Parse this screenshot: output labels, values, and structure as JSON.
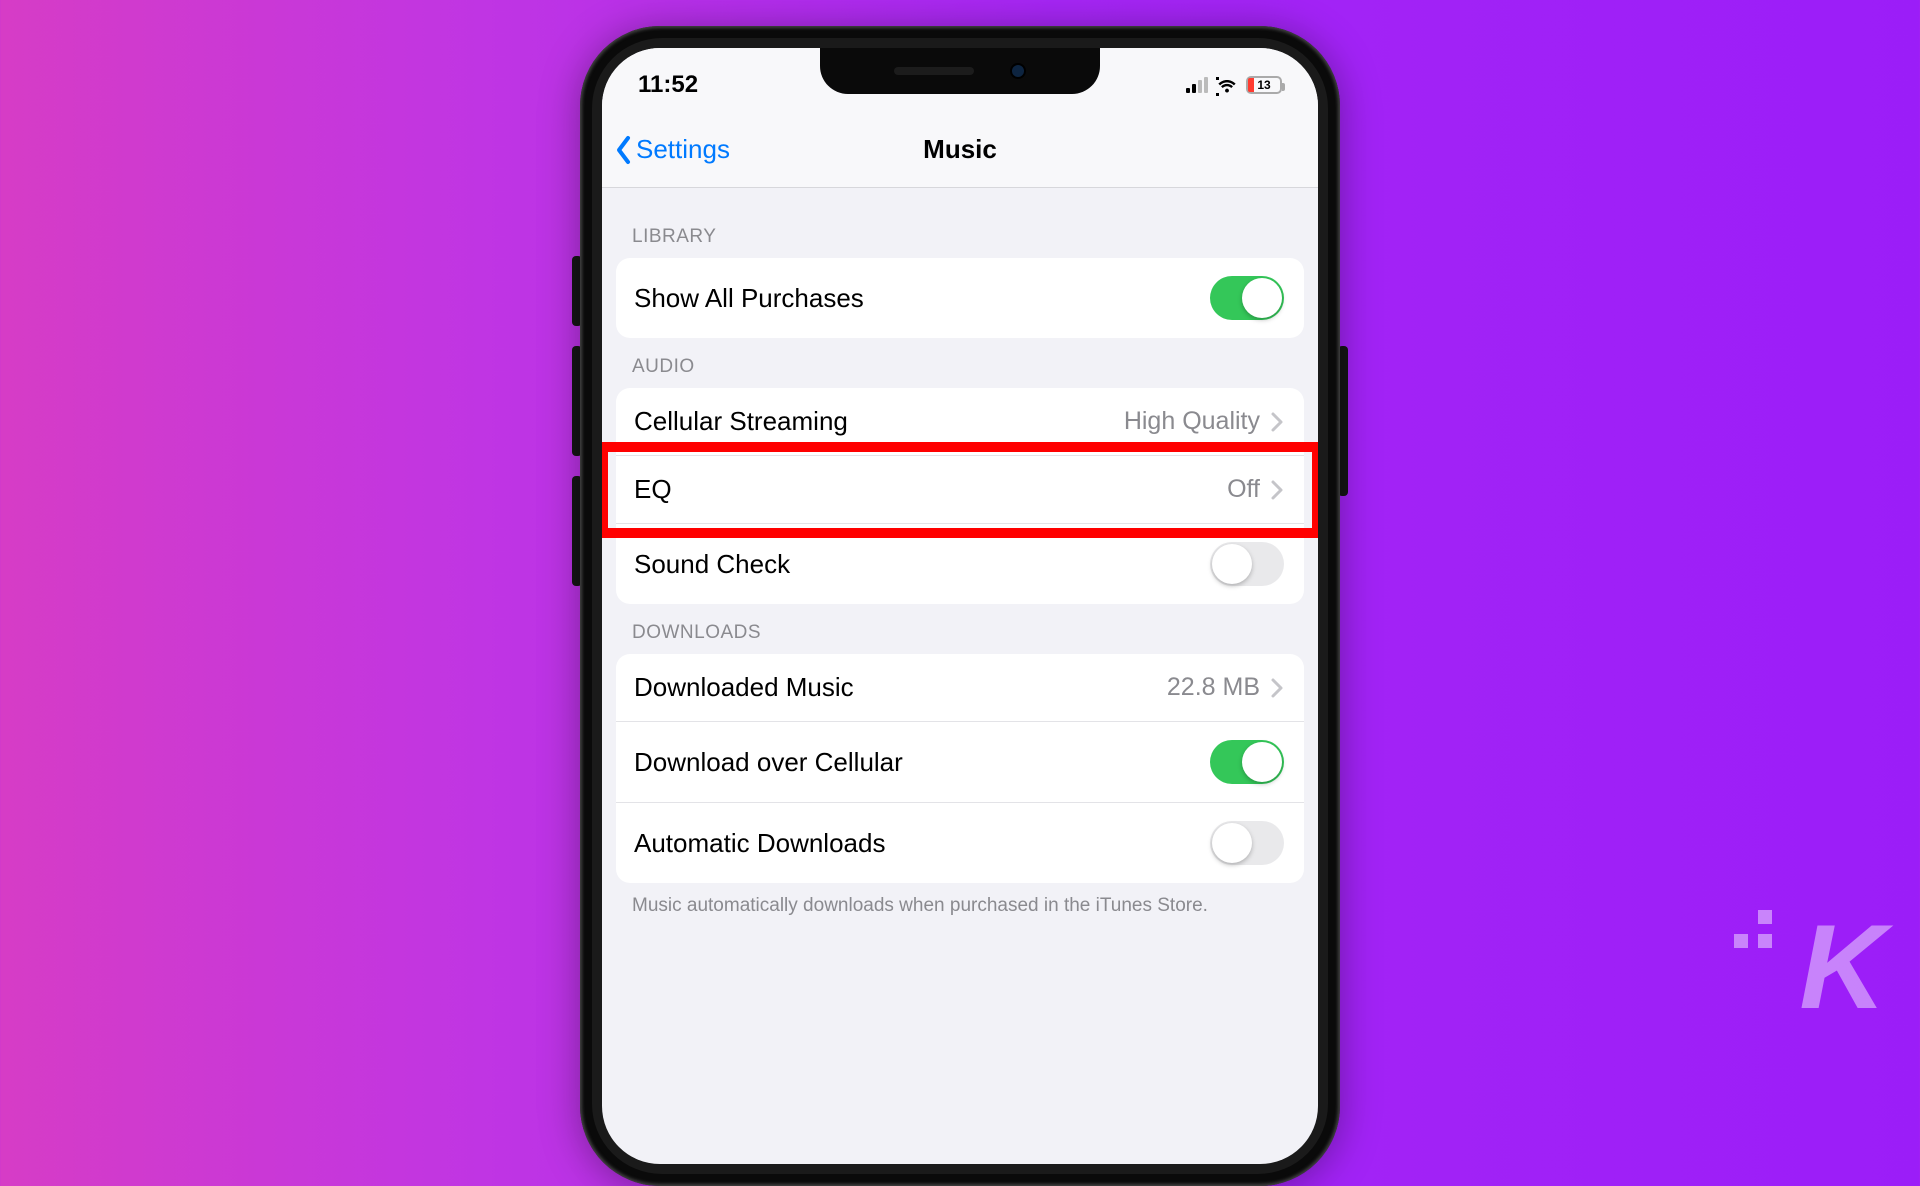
{
  "status": {
    "time": "11:52",
    "battery_percent": "13"
  },
  "nav": {
    "back_label": "Settings",
    "title": "Music"
  },
  "sections": {
    "library": {
      "header": "LIBRARY",
      "show_all_purchases": {
        "label": "Show All Purchases",
        "on": true
      }
    },
    "audio": {
      "header": "AUDIO",
      "cellular_streaming": {
        "label": "Cellular Streaming",
        "value": "High Quality"
      },
      "eq": {
        "label": "EQ",
        "value": "Off"
      },
      "sound_check": {
        "label": "Sound Check",
        "on": false
      }
    },
    "downloads": {
      "header": "DOWNLOADS",
      "downloaded_music": {
        "label": "Downloaded Music",
        "value": "22.8 MB"
      },
      "download_over_cellular": {
        "label": "Download over Cellular",
        "on": true
      },
      "automatic_downloads": {
        "label": "Automatic Downloads",
        "on": false
      },
      "footer": "Music automatically downloads when purchased in the iTunes Store."
    }
  },
  "annotation": {
    "highlight_target": "row-eq"
  },
  "watermark": {
    "letter": "K"
  }
}
